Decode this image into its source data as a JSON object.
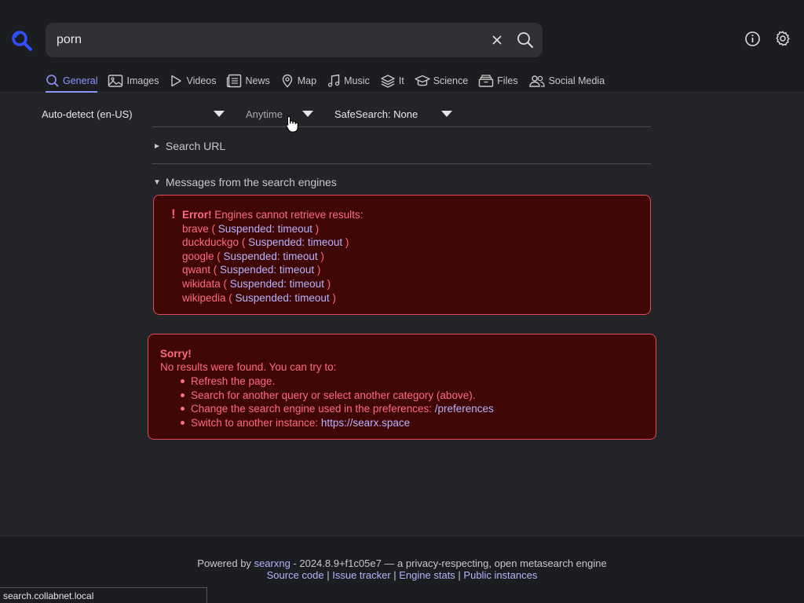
{
  "search": {
    "query": "porn",
    "placeholder": ""
  },
  "tabs": [
    {
      "label": "General",
      "icon": "search-icon",
      "active": true
    },
    {
      "label": "Images",
      "icon": "image-icon"
    },
    {
      "label": "Videos",
      "icon": "play-icon"
    },
    {
      "label": "News",
      "icon": "newspaper-icon"
    },
    {
      "label": "Map",
      "icon": "map-pin-icon"
    },
    {
      "label": "Music",
      "icon": "music-note-icon"
    },
    {
      "label": "It",
      "icon": "layers-icon"
    },
    {
      "label": "Science",
      "icon": "graduation-cap-icon"
    },
    {
      "label": "Files",
      "icon": "file-box-icon"
    },
    {
      "label": "Social Media",
      "icon": "people-icon"
    }
  ],
  "filters": {
    "language": "Auto-detect (en-US)",
    "time": "Anytime",
    "safesearch": "SafeSearch: None"
  },
  "search_url_label": "Search URL",
  "messages_label": "Messages from the search engines",
  "error": {
    "title": "Error!",
    "message": "Engines cannot retrieve results:",
    "engines": [
      {
        "name": "brave",
        "status": "Suspended: timeout"
      },
      {
        "name": "duckduckgo",
        "status": "Suspended: timeout"
      },
      {
        "name": "google",
        "status": "Suspended: timeout"
      },
      {
        "name": "qwant",
        "status": "Suspended: timeout"
      },
      {
        "name": "wikidata",
        "status": "Suspended: timeout"
      },
      {
        "name": "wikipedia",
        "status": "Suspended: timeout"
      }
    ]
  },
  "sorry": {
    "title": "Sorry!",
    "text": "No results were found. You can try to:",
    "items": [
      {
        "text": "Refresh the page.",
        "link": ""
      },
      {
        "text": "Search for another query or select another category (above).",
        "link": ""
      },
      {
        "text": "Change the search engine used in the preferences: ",
        "link": "/preferences"
      },
      {
        "text": "Switch to another instance: ",
        "link": "https://searx.space"
      }
    ]
  },
  "footer": {
    "powered_by": "Powered by",
    "project": "searxng",
    "tagline": " - 2024.8.9+f1c05e7 — a privacy-respecting, open metasearch engine",
    "links": [
      "Source code",
      "Issue tracker",
      "Engine stats",
      "Public instances"
    ]
  },
  "status_url": "search.collabnet.local",
  "colors": {
    "accent": "#8c95ff",
    "error_text": "#ff6b7d",
    "error_bg": "#400707",
    "link": "#b4b4ff"
  }
}
